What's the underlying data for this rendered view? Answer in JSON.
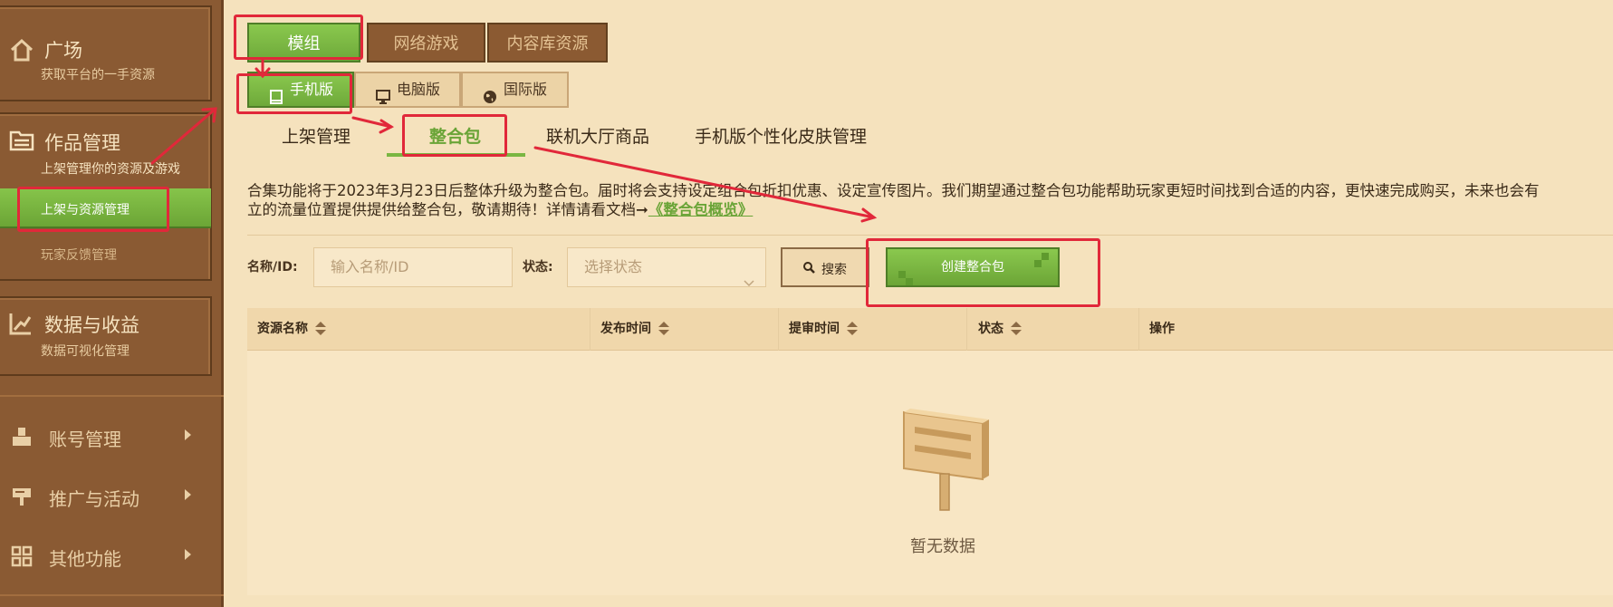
{
  "sidebar": {
    "plaza": {
      "title": "广场",
      "subtitle": "获取平台的一手资源"
    },
    "works": {
      "title": "作品管理",
      "subtitle": "上架管理你的资源及游戏",
      "active_item": "上架与资源管理",
      "item2": "玩家反馈管理"
    },
    "data": {
      "title": "数据与收益",
      "subtitle": "数据可视化管理"
    },
    "menu": [
      {
        "label": "账号管理",
        "icon": "account-icon"
      },
      {
        "label": "推广与活动",
        "icon": "promo-sign-icon"
      },
      {
        "label": "其他功能",
        "icon": "grid-icon"
      }
    ]
  },
  "tabs_top": [
    "模组",
    "网络游戏",
    "内容库资源"
  ],
  "tabs_platform": [
    {
      "label": "手机版",
      "icon": "tablet-icon"
    },
    {
      "label": "电脑版",
      "icon": "monitor-icon"
    },
    {
      "label": "国际版",
      "icon": "globe-icon"
    }
  ],
  "tabs_sub": [
    "上架管理",
    "整合包",
    "联机大厅商品",
    "手机版个性化皮肤管理"
  ],
  "notice": {
    "line1": "合集功能将于2023年3月23日后整体升级为整合包。届时将会支持设定组合包折扣优惠、设定宣传图片。我们期望通过整合包功能帮助玩家更短时间找到合适的内容，更快速完成购买，未来也会有",
    "line2": "立的流量位置提供提供给整合包，敬请期待！详情请看文档➞",
    "link": "《整合包概览》"
  },
  "filters": {
    "name_label": "名称/ID:",
    "name_placeholder": "输入名称/ID",
    "status_label": "状态:",
    "status_placeholder": "选择状态",
    "search_label": "搜索",
    "create_label": "创建整合包"
  },
  "table": {
    "headers": [
      "资源名称",
      "发布时间",
      "提审时间",
      "状态",
      "操作"
    ],
    "empty_text": "暂无数据"
  },
  "colors": {
    "accent_green": "#7ab642",
    "sidebar_brown": "#8a5a33",
    "page_bg": "#f5e2bd",
    "annotation_red": "#e1283a"
  }
}
